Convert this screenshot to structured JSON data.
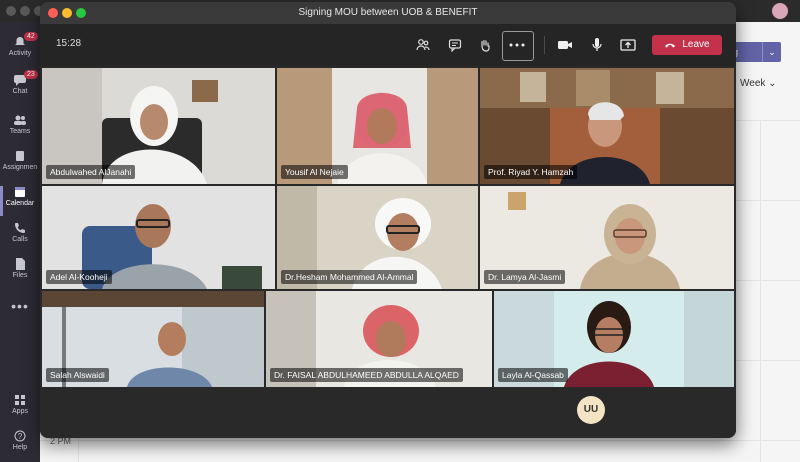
{
  "meeting": {
    "title": "Signing MOU between UOB & BENEFIT",
    "clock": "15:28",
    "leave_label": "Leave",
    "self_avatar_initials": "UU"
  },
  "rail": {
    "items": [
      {
        "label": "Activity",
        "badge": "42"
      },
      {
        "label": "Chat",
        "badge": "23"
      },
      {
        "label": "Teams",
        "badge": ""
      },
      {
        "label": "Assignmen",
        "badge": ""
      },
      {
        "label": "Calendar",
        "badge": ""
      },
      {
        "label": "Calls",
        "badge": ""
      },
      {
        "label": "Files",
        "badge": ""
      },
      {
        "label": "Apps",
        "badge": ""
      },
      {
        "label": "Help",
        "badge": ""
      }
    ]
  },
  "calendar": {
    "view_label": "Week",
    "join_label": "ng",
    "time_label": "2 PM"
  },
  "participants": [
    {
      "name": "Abdulwahed AlJanahi"
    },
    {
      "name": "Yousif Al Nejaie"
    },
    {
      "name": "Prof. Riyad Y. Hamzah"
    },
    {
      "name": "Adel Al-Kooheji"
    },
    {
      "name": "Dr.Hesham Mohammed Al-Ammal"
    },
    {
      "name": "Dr. Lamya Al-Jasmi"
    },
    {
      "name": "Salah Alswaidi"
    },
    {
      "name": "Dr. FAISAL ABDULHAMEED ABDULLA ALQAED"
    },
    {
      "name": "Layla Al-Qassab"
    }
  ],
  "colors": {
    "leave": "#c4314b",
    "accent": "#6264a7",
    "rail": "#2d2c35"
  }
}
